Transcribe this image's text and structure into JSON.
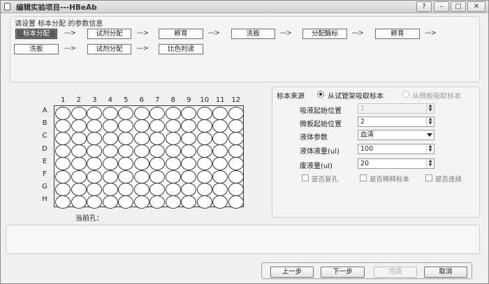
{
  "window": {
    "title": "编辑实验项目---HBeAb",
    "controls": [
      "?",
      "–",
      "□",
      "✕"
    ]
  },
  "steps": {
    "info_label": "请设置 标本分配 的参数信息",
    "row1": [
      "标本分配",
      "试剂分配",
      "孵育",
      "洗板",
      "分配酶标",
      "孵育"
    ],
    "row2": [
      "洗板",
      "试剂分配",
      "比色判读"
    ],
    "arrow": "--->"
  },
  "plate": {
    "columns": [
      "1",
      "2",
      "3",
      "4",
      "5",
      "6",
      "7",
      "8",
      "9",
      "10",
      "11",
      "12"
    ],
    "rows": [
      "A",
      "B",
      "C",
      "D",
      "E",
      "F",
      "G",
      "H"
    ],
    "current_well_label": "当前孔："
  },
  "sample_source": {
    "label": "标本来源",
    "option_tube": "从试管架吸取标本",
    "option_plate": "从微板吸取标本",
    "fields": {
      "aspirate_start_label": "吸液起始位置",
      "aspirate_start_value": "1",
      "plate_start_label": "微板起始位置",
      "plate_start_value": "2",
      "liquid_param_label": "液体参数",
      "liquid_param_value": "血清",
      "liquid_volume_label": "液体液量(ul)",
      "liquid_volume_value": "100",
      "waste_volume_label": "废液量(ul)",
      "waste_volume_value": "20"
    },
    "checkboxes": {
      "duplicate": "是否复孔",
      "dilute": "是否稀释标本",
      "continuous": "是否连续"
    }
  },
  "buttons": {
    "prev": "上一步",
    "next": "下一步",
    "finish": "完成",
    "cancel": "取消"
  }
}
